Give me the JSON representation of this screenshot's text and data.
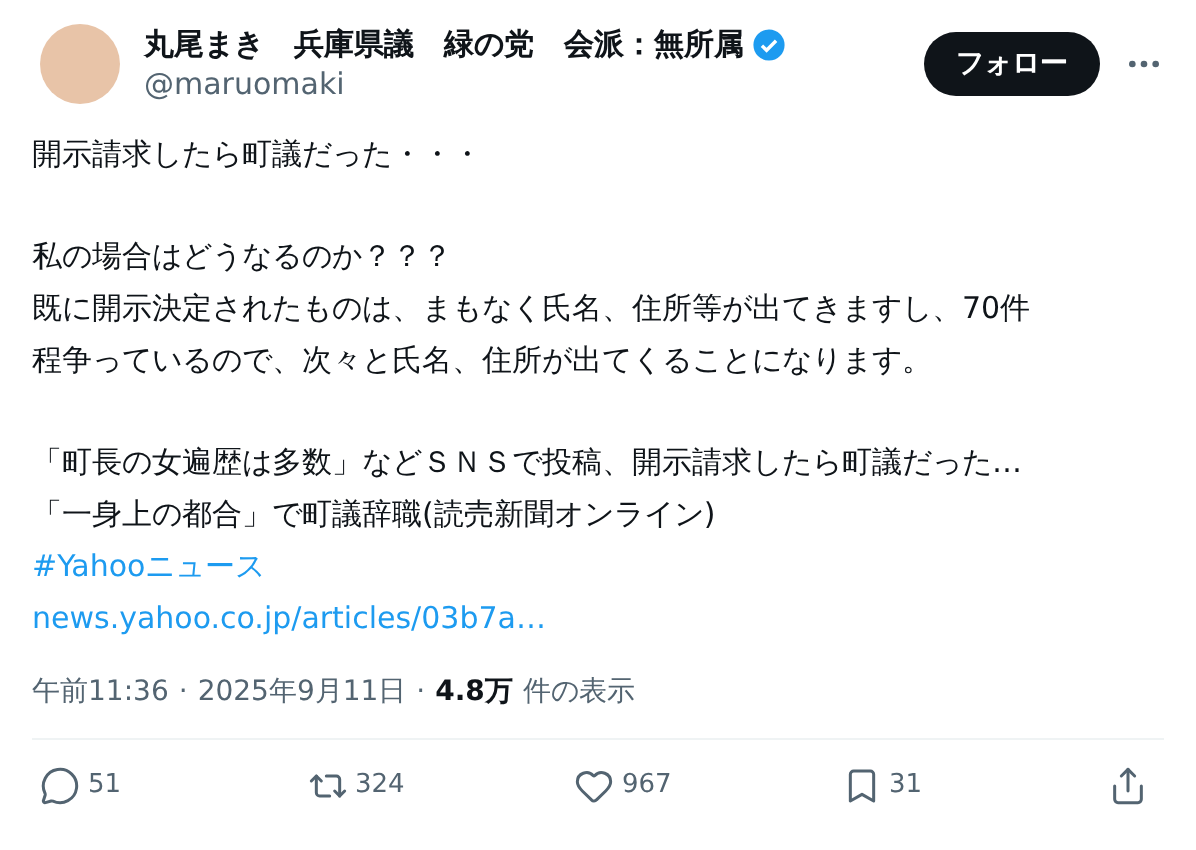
{
  "author": {
    "name": "丸尾まき　兵庫県議　緑の党　会派：無所属",
    "verified": true,
    "handle": "@maruomaki"
  },
  "follow_button": "フォロー",
  "body": [
    {
      "lines": [
        {
          "kind": "text",
          "text": "開示請求したら町議だった・・・"
        }
      ]
    },
    {
      "lines": [
        {
          "kind": "text",
          "text": "私の場合はどうなるのか？？？"
        },
        {
          "kind": "text",
          "text": "既に開示決定されたものは、まもなく氏名、住所等が出てきますし、70件"
        },
        {
          "kind": "text",
          "text": "程争っているので、次々と氏名、住所が出てくることになります。"
        }
      ]
    },
    {
      "lines": [
        {
          "kind": "text",
          "text": "「町長の女遍歴は多数」などＳＮＳで投稿、開示請求したら町議だった…"
        },
        {
          "kind": "text",
          "text": "「一身上の都合」で町議辞職(読売新聞オンライン)"
        },
        {
          "kind": "hashtag",
          "text": "#Yahooニュース"
        },
        {
          "kind": "link",
          "text": "news.yahoo.co.jp/articles/03b7a…"
        }
      ]
    }
  ],
  "meta": {
    "time": "午前11:36",
    "separator_1": "·",
    "date": "2025年9月11日",
    "separator_2": "·",
    "views": "4.8万",
    "views_label": "件の表示"
  },
  "actions": [
    {
      "kind": "reply",
      "count": "51"
    },
    {
      "kind": "repost",
      "count": "324"
    },
    {
      "kind": "like",
      "count": "967"
    },
    {
      "kind": "bookmark",
      "count": "31"
    },
    {
      "kind": "share"
    }
  ]
}
